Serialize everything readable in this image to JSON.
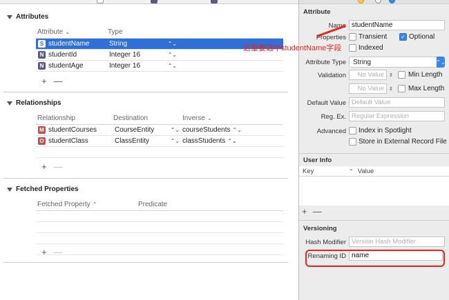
{
  "editor": {
    "attributes": {
      "title": "Attributes",
      "columns": {
        "attribute": "Attribute",
        "type": "Type"
      },
      "rows": [
        {
          "badge": "S",
          "name": "studentName",
          "type": "String"
        },
        {
          "badge": "N",
          "name": "studentId",
          "type": "Integer 16"
        },
        {
          "badge": "N",
          "name": "studentAge",
          "type": "Integer 16"
        }
      ]
    },
    "relationships": {
      "title": "Relationships",
      "columns": {
        "relationship": "Relationship",
        "destination": "Destination",
        "inverse": "Inverse"
      },
      "rows": [
        {
          "badge": "M",
          "name": "studentCourses",
          "destination": "CourseEntity",
          "inverse": "courseStudents"
        },
        {
          "badge": "O",
          "name": "studentClass",
          "destination": "ClassEntity",
          "inverse": "classStudents"
        }
      ]
    },
    "fetched": {
      "title": "Fetched Properties",
      "columns": {
        "property": "Fetched Property",
        "predicate": "Predicate"
      }
    },
    "plus": "+",
    "minus": "—"
  },
  "annotation": "这里要选中studentName字段",
  "inspector": {
    "attribute": {
      "title": "Attribute",
      "name_label": "Name",
      "name_value": "studentName",
      "properties_label": "Properties",
      "transient": "Transient",
      "optional": "Optional",
      "indexed": "Indexed",
      "attr_type_label": "Attribute Type",
      "attr_type_value": "String",
      "validation_label": "Validation",
      "no_value": "No Value",
      "min_length": "Min Length",
      "max_length": "Max Length",
      "default_label": "Default Value",
      "default_ph": "Default Value",
      "regex_label": "Reg. Ex.",
      "regex_ph": "Regular Expression",
      "advanced_label": "Advanced",
      "spotlight": "Index in Spotlight",
      "external": "Store in External Record File"
    },
    "user_info": {
      "title": "User Info",
      "key": "Key",
      "value": "Value"
    },
    "versioning": {
      "title": "Versioning",
      "hash_label": "Hash Modifier",
      "hash_ph": "Version Hash Modifier",
      "renaming_label": "Renaming ID",
      "renaming_value": "name"
    }
  },
  "colors": {
    "selection": "#2e6fd8",
    "annotation": "#e8231e",
    "accent": "#3a86e8"
  }
}
